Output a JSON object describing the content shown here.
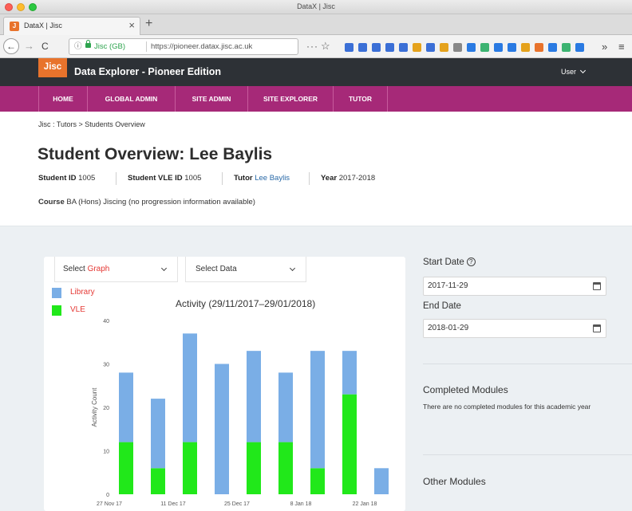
{
  "window": {
    "title": "DataX | Jisc"
  },
  "browser": {
    "tab_label": "DataX | Jisc",
    "tab_favicon": "J",
    "tab_close": "×",
    "new_tab": "+",
    "url_info_icon": "ⓘ",
    "url_site": "Jisc (GB)",
    "url": "https://pioneer.datax.jisc.ac.uk",
    "more": "···",
    "star": "☆",
    "overflow": "»",
    "menu": "≡",
    "back": "←",
    "forward": "→",
    "reload": "C",
    "extension_colors": [
      "#3b6fd6",
      "#3b6fd6",
      "#3b6fd6",
      "#3b6fd6",
      "#3b6fd6",
      "#e5a21c",
      "#3b6fd6",
      "#e5a21c",
      "#888888",
      "#2a7ae2",
      "#3cb371",
      "#2a7ae2",
      "#2a7ae2",
      "#e5a21c",
      "#e8732c",
      "#2a7ae2",
      "#3cb371",
      "#2a7ae2"
    ]
  },
  "app": {
    "logo": "Jisc",
    "title": "Data Explorer - Pioneer Edition",
    "user_label": "User",
    "nav": [
      {
        "label": "HOME"
      },
      {
        "label": "GLOBAL ADMIN"
      },
      {
        "label": "SITE ADMIN"
      },
      {
        "label": "SITE EXPLORER"
      },
      {
        "label": "TUTOR"
      }
    ],
    "brand_color": "#a62978",
    "header_color": "#2d3136",
    "logo_color": "#e8732c"
  },
  "breadcrumb": "Jisc :  Tutors  >  Students Overview",
  "student": {
    "title": "Student Overview: Lee Baylis",
    "id_label": "Student ID",
    "id_value": "1005",
    "vle_label": "Student VLE ID",
    "vle_value": "1005",
    "tutor_label": "Tutor",
    "tutor_value": "Lee Baylis",
    "year_label": "Year",
    "year_value": "2017-2018",
    "course_label": "Course",
    "course_value": "BA (Hons) Jiscing (no progression information available)"
  },
  "selects": {
    "graph_prefix": "Select",
    "graph_value": "Graph",
    "data_label": "Select Data"
  },
  "filters": {
    "start_label": "Start Date",
    "start_value": "2017-11-29",
    "end_label": "End Date",
    "end_value": "2018-01-29",
    "help_icon": "?"
  },
  "sections": {
    "completed_title": "Completed Modules",
    "completed_text": "There are no completed modules for this academic year",
    "other_title": "Other Modules"
  },
  "chart_data": {
    "type": "bar",
    "stacked": true,
    "title": "Activity (29/11/2017–29/01/2018)",
    "ylabel": "Activity Count",
    "ylim": [
      0,
      40
    ],
    "yticks": [
      0,
      10,
      20,
      30,
      40
    ],
    "xticks": [
      "27 Nov 17",
      "11 Dec 17",
      "25 Dec 17",
      "8 Jan 18",
      "22 Jan 18"
    ],
    "categories": [
      "1",
      "2",
      "3",
      "4",
      "5",
      "6",
      "7",
      "8",
      "9"
    ],
    "series": [
      {
        "name": "Library",
        "color": "#7aaee6",
        "values": [
          16,
          16,
          25,
          30,
          21,
          16,
          27,
          10,
          6
        ]
      },
      {
        "name": "VLE",
        "color": "#21e81a",
        "values": [
          12,
          6,
          12,
          0,
          12,
          12,
          6,
          23,
          0
        ]
      }
    ],
    "legend_position": "top-left"
  }
}
